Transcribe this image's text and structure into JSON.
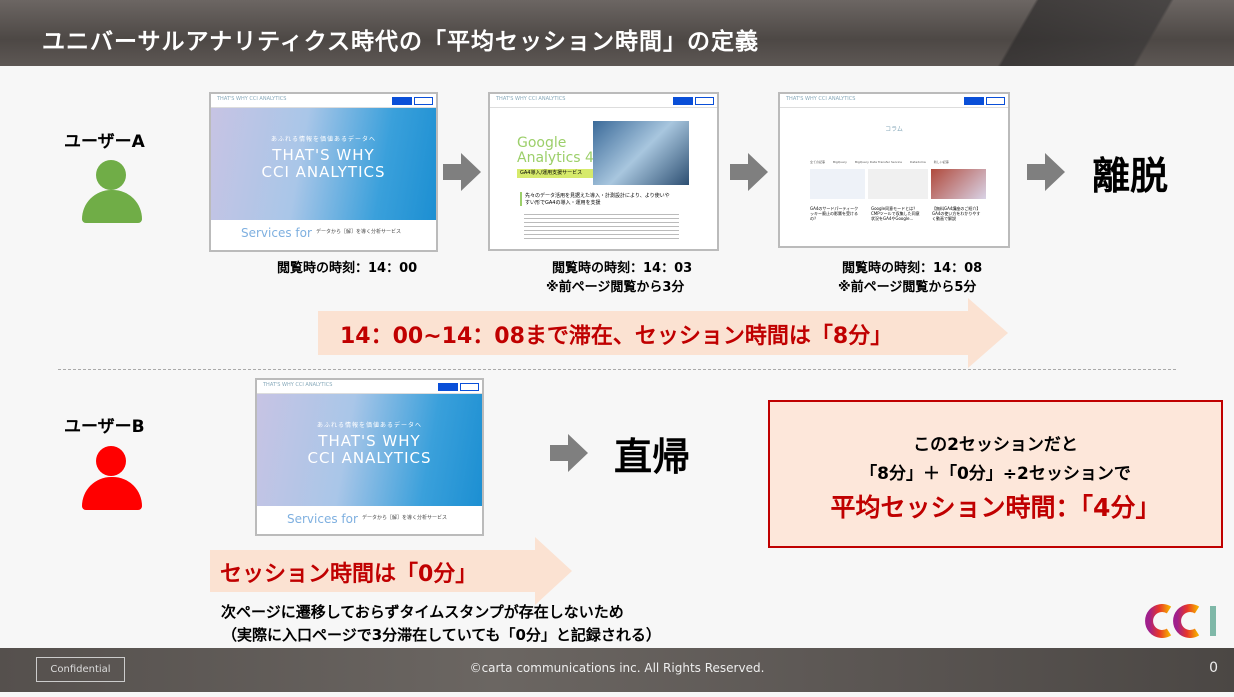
{
  "slide": {
    "title": "ユニバーサルアナリティクス時代の「平均セッション時間」の定義"
  },
  "user_a": {
    "label": "ユーザーA",
    "icon_color": "#70ad47",
    "pages": [
      {
        "logo": "THAT'S WHY CCI ANALYTICS",
        "hero_sub": "あふれる情報を価値あるデータへ",
        "hero_title": "THAT'S WHY CCI ANALYTICS",
        "services": "Services for",
        "services_sub": "データから［解］を導く分析サービス",
        "caption1": "閲覧時の時刻：14：00",
        "caption2": ""
      },
      {
        "logo": "THAT'S WHY CCI ANALYTICS",
        "heading": "Google Analytics 4",
        "badge": "GA4導入/運用支援サービス",
        "lead": "先々のデータ活用を見据えた導入・計測設計により、より使いやすい形でGA4の導入・運用を支援",
        "caption1": "閲覧時の時刻：14：03",
        "caption2": "※前ページ閲覧から3分"
      },
      {
        "logo": "THAT'S WHY CCI ANALYTICS",
        "heading": "コラム",
        "tabs": [
          "全ての記事",
          "BigQuery",
          "BigQuery Data Transfer Service",
          "Datadoma",
          "新しい記事"
        ],
        "articles": [
          "GA4のサードパーティークッキー廃止の影響を受けるの？",
          "Google同意モードとは？CMPツールで収集した同意状況をGA4やGoogle...",
          "【無料GA4講座のご紹介】GA4の使い方をわかりやすく動画で解説"
        ],
        "caption1": "閲覧時の時刻：14：08",
        "caption2": "※前ページ閲覧から5分"
      }
    ],
    "outcome": "離脱",
    "banner": "14：00~14：08まで滞在、セッション時間は「8分」"
  },
  "user_b": {
    "label": "ユーザーB",
    "icon_color": "#ff0000",
    "page": {
      "logo": "THAT'S WHY CCI ANALYTICS",
      "hero_sub": "あふれる情報を価値あるデータへ",
      "hero_title": "THAT'S WHY CCI ANALYTICS",
      "services": "Services for",
      "services_sub": "データから［解］を導く分析サービス"
    },
    "outcome": "直帰",
    "banner": "セッション時間は「0分」",
    "note1": "次ページに遷移しておらずタイムスタンプが存在しないため",
    "note2": "（実際に入口ページで3分滞在していても「0分」と記録される）"
  },
  "summary": {
    "line1": "この2セッションだと",
    "line2": "「8分」＋「0分」÷2セッションで",
    "line3": "平均セッション時間：「4分」"
  },
  "colors": {
    "accent_red": "#c00000",
    "banner_fill": "#fbe2d2",
    "arrow_gray": "#7f7f7f"
  },
  "logo": {
    "text": "CCI"
  },
  "footer": {
    "confidential": "Confidential",
    "copyright": "©carta communications inc. All Rights Reserved.",
    "page_number": "0"
  }
}
